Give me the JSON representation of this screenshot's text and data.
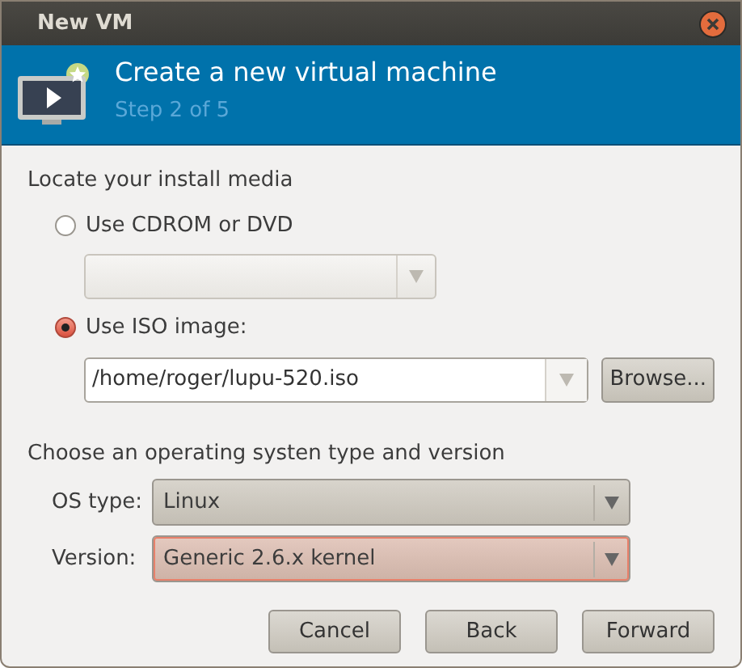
{
  "window": {
    "title": "New VM"
  },
  "header": {
    "title": "Create a new virtual machine",
    "step": "Step 2 of 5"
  },
  "media": {
    "label": "Locate your install media",
    "options": [
      {
        "label": "Use CDROM or DVD",
        "selected": false,
        "input": {
          "kind": "combo",
          "disabled": true
        }
      },
      {
        "label": "Use ISO image:",
        "selected": true,
        "input": {
          "kind": "entry",
          "disabled": false,
          "value": "/home/roger/lupu-520.iso",
          "button": "Browse..."
        }
      }
    ]
  },
  "os": {
    "label": "Choose an operating systen type and version",
    "fields": [
      {
        "label": "OS type:",
        "value": "Linux",
        "focused": false
      },
      {
        "label": "Version:",
        "value": "Generic 2.6.x kernel",
        "focused": true
      }
    ]
  },
  "buttons": [
    "Cancel",
    "Back",
    "Forward"
  ]
}
